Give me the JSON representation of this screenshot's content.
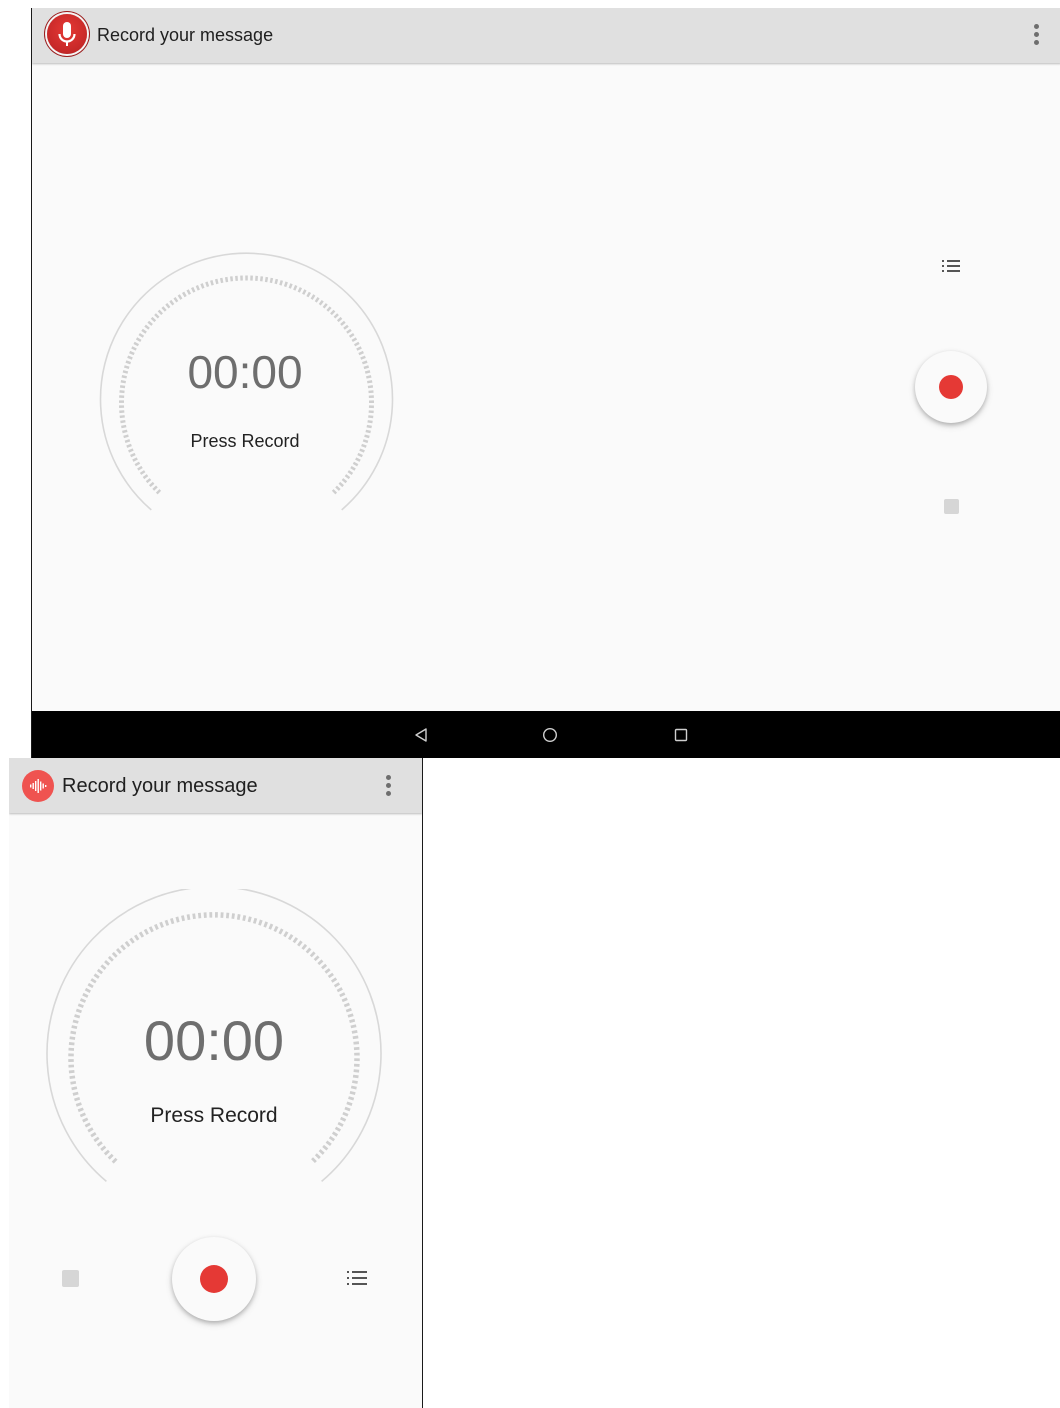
{
  "tablet": {
    "appbar": {
      "title": "Record your message",
      "logo_icon": "microphone-app-icon",
      "menu_icon": "more-vert-icon"
    },
    "timer": "00:00",
    "status": "Press Record",
    "controls": {
      "list_icon": "recordings-list-icon",
      "record_icon": "record-icon",
      "stop_icon": "stop-icon"
    },
    "navbar": {
      "back_icon": "back-icon",
      "home_icon": "home-icon",
      "recents_icon": "recents-icon"
    }
  },
  "phone": {
    "appbar": {
      "title": "Record your message",
      "logo_icon": "sound-wave-app-icon",
      "menu_icon": "more-vert-icon"
    },
    "timer": "00:00",
    "status": "Press Record",
    "controls": {
      "stop_icon": "stop-icon",
      "record_icon": "record-icon",
      "list_icon": "recordings-list-icon"
    }
  },
  "colors": {
    "accent": "#e53935",
    "appbar": "#e0e0e0",
    "background": "#fafafa",
    "timer_text": "#6e6e6e",
    "navbar": "#000000"
  }
}
